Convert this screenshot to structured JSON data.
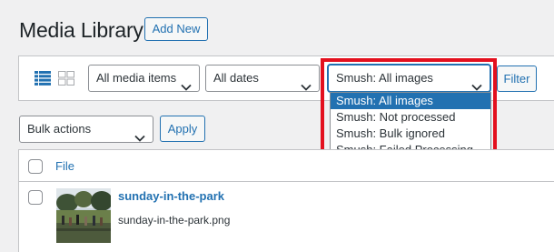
{
  "header": {
    "title": "Media Library",
    "add_new_label": "Add New"
  },
  "toolbar": {
    "view_modes": [
      "list-view-icon",
      "grid-view-icon"
    ],
    "media_filter": {
      "value": "All media items"
    },
    "date_filter": {
      "value": "All dates"
    },
    "smush_filter": {
      "value": "Smush: All images",
      "options": [
        "Smush: All images",
        "Smush: Not processed",
        "Smush: Bulk ignored",
        "Smush: Failed Processing"
      ],
      "selected_index": 0
    },
    "filter_label": "Filter"
  },
  "bulk": {
    "value": "Bulk actions",
    "apply_label": "Apply"
  },
  "table": {
    "columns": [
      "File"
    ],
    "rows": [
      {
        "title": "sunday-in-the-park",
        "filename": "sunday-in-the-park.png"
      }
    ]
  },
  "colors": {
    "accent": "#2271b1",
    "highlight": "#e3101e",
    "background": "#f0f0f1"
  }
}
